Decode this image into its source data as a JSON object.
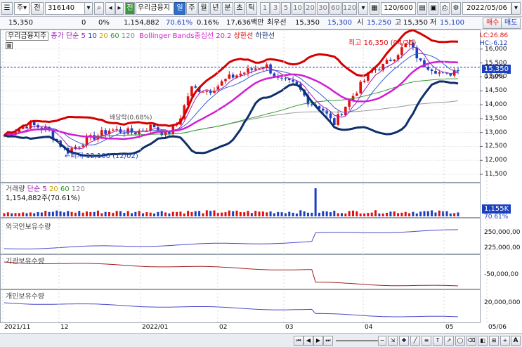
{
  "toolbar": {
    "market_label": "주",
    "period_label": "전",
    "code": "316140",
    "name_badge": "전",
    "stock_name": "우리금융지",
    "period_tabs": [
      "일",
      "주",
      "월",
      "년",
      "분",
      "초",
      "틱"
    ],
    "minute_tabs": [
      "1",
      "3",
      "5",
      "10",
      "20",
      "30",
      "60",
      "120"
    ],
    "count_value": "120/600",
    "date_value": "2022/05/06"
  },
  "quote": {
    "price": "15,350",
    "change": "0",
    "change_pct": "0%",
    "volume": "1,154,882",
    "volume_ratio": "70.61%",
    "turnover": "0.16%",
    "amount": "17,636백만",
    "ask_label": "최우선",
    "ask": "15,350",
    "bid": "15,300",
    "open_label": "시",
    "open": "15,250",
    "high_label": "고",
    "high": "15,350",
    "low_label": "저",
    "low": "15,100",
    "buy_label": "매수",
    "sell_label": "매도"
  },
  "price_panel": {
    "title": "우리금융지주",
    "ma_label": "종가 단순",
    "ma_periods": [
      "5",
      "10",
      "20",
      "60",
      "120"
    ],
    "bb_label": "Bollinger Bands중심선 20.2",
    "bb_upper": "상한선",
    "bb_lower": "하한선",
    "high_note": "최고 16,350 (04/25)",
    "low_note": "←최저 12,100 (12/02)",
    "strike_note": "배당락(0.68%)",
    "lc_note": "LC:26.86",
    "hc_note": "HC:-6.12",
    "current_tag": "15,350",
    "pct_tag": "0.00%",
    "y_ticks": [
      "16,000",
      "15,500",
      "15,000",
      "14,500",
      "14,000",
      "13,500",
      "13,000",
      "12,500",
      "12,000",
      "11,500"
    ]
  },
  "volume_panel": {
    "title": "거래량",
    "ma_label": "단순",
    "ma_periods": [
      "5",
      "20",
      "60",
      "120"
    ],
    "value_label": "1,154,882주(70.61%)",
    "tag": "1,155K",
    "tag_pct": "70.61%"
  },
  "foreign_panel": {
    "title": "외국인보유수량",
    "ticks": [
      "250,000,00",
      "225,000,00"
    ]
  },
  "inst_panel": {
    "title": "기관보유수량",
    "ticks": [
      "-50,000,00"
    ]
  },
  "indiv_panel": {
    "title": "개인보유수량",
    "ticks": [
      "20,000,000"
    ]
  },
  "x_axis": [
    "2021/11",
    "12",
    "2022/01",
    "02",
    "03",
    "04",
    "05",
    "05/06"
  ],
  "colors": {
    "up": "#e01010",
    "down": "#1a3fbf",
    "ma5": "#9a1fb8",
    "ma20": "#2e9a2e",
    "bb_mid": "#d11ed1",
    "bb_upper": "#d40000",
    "bb_lower": "#0e2f6b",
    "volume": "#e01010",
    "foreign": "#4a4ac8",
    "inst": "#a02020",
    "indiv": "#4a4ac8"
  },
  "scroll": {
    "zoom_minus": "−",
    "zoom_plus": "+"
  }
}
